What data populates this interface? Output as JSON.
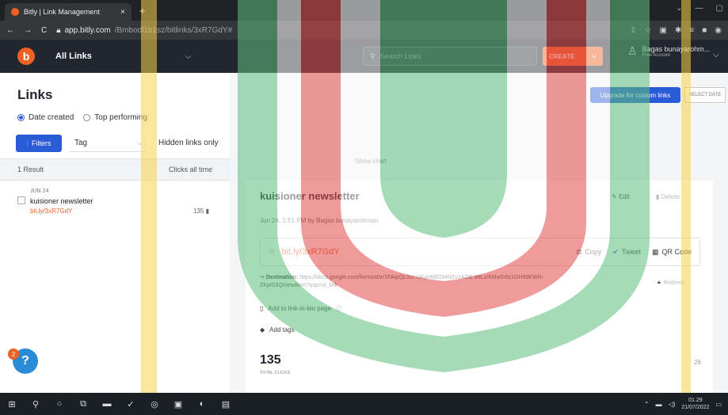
{
  "browser": {
    "tab_title": "Bitly | Link Management",
    "tab_close": "×",
    "new_tab": "+",
    "url_host": "app.bitly.com",
    "url_path": "/Bmbodl1b1sz/bitlinks/3xR7GdY#"
  },
  "header": {
    "logo": "b",
    "group_label": "All Links",
    "search_placeholder": "Search Links",
    "create_label": "CREATE",
    "user_name": "Bagas bunayarohm...",
    "user_plan": "Free Account"
  },
  "page": {
    "title": "Links",
    "sort_options": [
      "Date created",
      "Top performing"
    ],
    "filters_label": "Filters",
    "tag_label": "Tag",
    "hidden_links_label": "Hidden links only",
    "upgrade_label": "Upgrade for custom links",
    "select_date_label": "SELECT DATE",
    "show_chart_label": "Show chart"
  },
  "list": {
    "result_count": "1 Result",
    "sort_label": "Clicks all time",
    "items": [
      {
        "date": "JUN 24",
        "title": "kuisioner newsletter",
        "link": "bit.ly/3xR7GdY",
        "clicks": "135"
      }
    ]
  },
  "detail": {
    "title": "kuisioner newsletter",
    "edit_label": "Edit",
    "delete_label": "Delete",
    "meta": "Jun 24, 1:51 PM by Bagas bunayarohman",
    "short_link": "bit.ly/3xR7GdY",
    "copy_label": "Copy",
    "tweet_label": "Tweet",
    "qr_label": "QR Code",
    "destination_label": "Destination:",
    "destination_url": "https://docs.google.com/forms/d/e/1FAIpQLScr-UKyHMEDHN0VzAOB-99Lu/K6iw0r8z1GH9dKWN-ZKpIS5Q/viewform?usp=sf_link",
    "redirect_label": "Redirect",
    "link_in_bio_label": "Add to link-in-bio page",
    "add_tags_label": "Add tags",
    "total_clicks": "135",
    "total_clicks_label": "TOTAL CLICKS"
  },
  "help": {
    "badge": "2",
    "icon": "?"
  },
  "scroll_indicator": "26",
  "taskbar": {
    "time": "01.29",
    "date": "21/07/2022"
  },
  "colors": {
    "brand_orange": "#ee6123",
    "brand_blue": "#2a5bd7",
    "header_dark": "#22262e"
  }
}
